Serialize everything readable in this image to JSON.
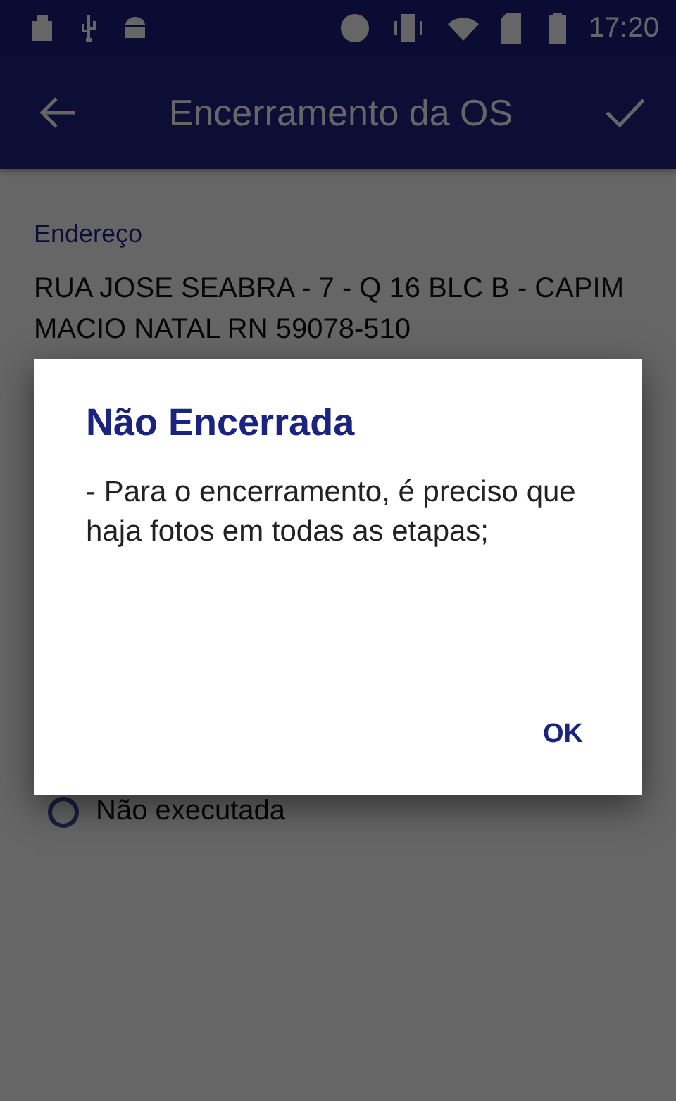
{
  "status_bar": {
    "time": "17:20"
  },
  "toolbar": {
    "title": "Encerramento da OS"
  },
  "address": {
    "label": "Endereço",
    "value": "RUA JOSE SEABRA - 7 - Q 16 BLC B - CAPIM MACIO NATAL RN 59078-510"
  },
  "options": [
    {
      "label": "Não executada",
      "selected": false
    }
  ],
  "dialog": {
    "title": "Não Encerrada",
    "message": "- Para o encerramento, é preciso que haja fotos em todas as etapas;",
    "buttons": [
      "OK"
    ]
  }
}
